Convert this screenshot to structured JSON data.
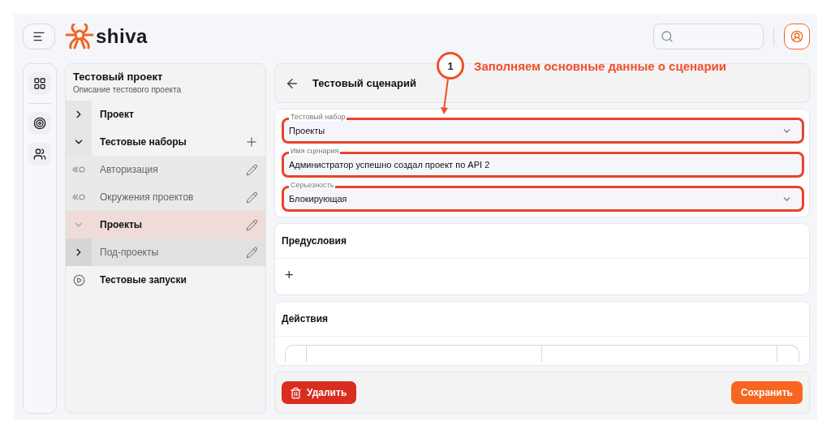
{
  "app": {
    "logo": "shiva"
  },
  "sidebar": {
    "project_title": "Тестовый проект",
    "project_description": "Описание тестового проекта",
    "items": [
      {
        "kind": "section",
        "label": "Проект",
        "expanded": false,
        "selected": false
      },
      {
        "kind": "section",
        "label": "Тестовые наборы",
        "expanded": true,
        "selected": false,
        "children": [
          {
            "kind": "suite",
            "label": "Авторизация",
            "selected": false
          },
          {
            "kind": "suite",
            "label": "Окружения проектов",
            "selected": false
          },
          {
            "kind": "branch",
            "label": "Проекты",
            "expanded": true,
            "selected": true,
            "children": [
              {
                "kind": "branch",
                "label": "Под-проекты",
                "expanded": false,
                "selected": false
              }
            ]
          }
        ]
      },
      {
        "kind": "runs",
        "label": "Тестовые запуски",
        "selected": false
      }
    ]
  },
  "header": {
    "title": "Тестовый сценарий"
  },
  "annotation": {
    "number": "1",
    "text": "Заполняем основные данные о сценарии"
  },
  "form": [
    {
      "kind": "select",
      "label": "Тестовый набор",
      "value": "Проекты",
      "highlighted": true
    },
    {
      "kind": "text",
      "label": "Имя сценария",
      "value": "Администратор успешно создал проект по API 2",
      "highlighted": true
    },
    {
      "kind": "select",
      "label": "Серьезность",
      "value": "Блокирующая",
      "highlighted": true
    }
  ],
  "preconditions": {
    "title": "Предусловия",
    "add": "+"
  },
  "actions": {
    "title": "Действия"
  },
  "footer": {
    "delete": "Удалить",
    "save": "Сохранить"
  }
}
